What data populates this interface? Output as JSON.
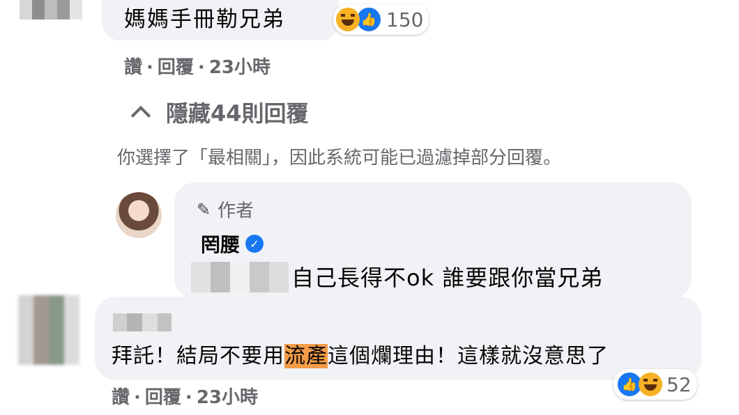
{
  "comment1": {
    "text": "媽媽手冊勒兄弟",
    "reaction_count": "150",
    "meta": {
      "like": "讚",
      "reply": "回覆",
      "time": "23小時"
    }
  },
  "replies_toggle": {
    "label": "隱藏44則回覆"
  },
  "filter_note": "你選擇了「最相關」，因此系統可能已過濾掉部分回覆。",
  "author_reply": {
    "badge": "作者",
    "name": "罔腰",
    "text": "自己長得不ok 誰要跟你當兄弟"
  },
  "comment2": {
    "text_before": "拜託！結局不要用",
    "text_highlight": "流產",
    "text_after": "這個爛理由！這樣就沒意思了",
    "reaction_count": "52",
    "meta": {
      "like": "讚",
      "reply": "回覆",
      "time": "23小時"
    }
  },
  "colors": {
    "link_blue": "#1877f2",
    "bubble_bg": "#f0f2f5",
    "meta_gray": "#65676b",
    "highlight": "#f49b47"
  },
  "icons": [
    "haha-reaction-icon",
    "like-reaction-icon",
    "pencil-icon",
    "verified-icon",
    "caret-up-icon"
  ]
}
